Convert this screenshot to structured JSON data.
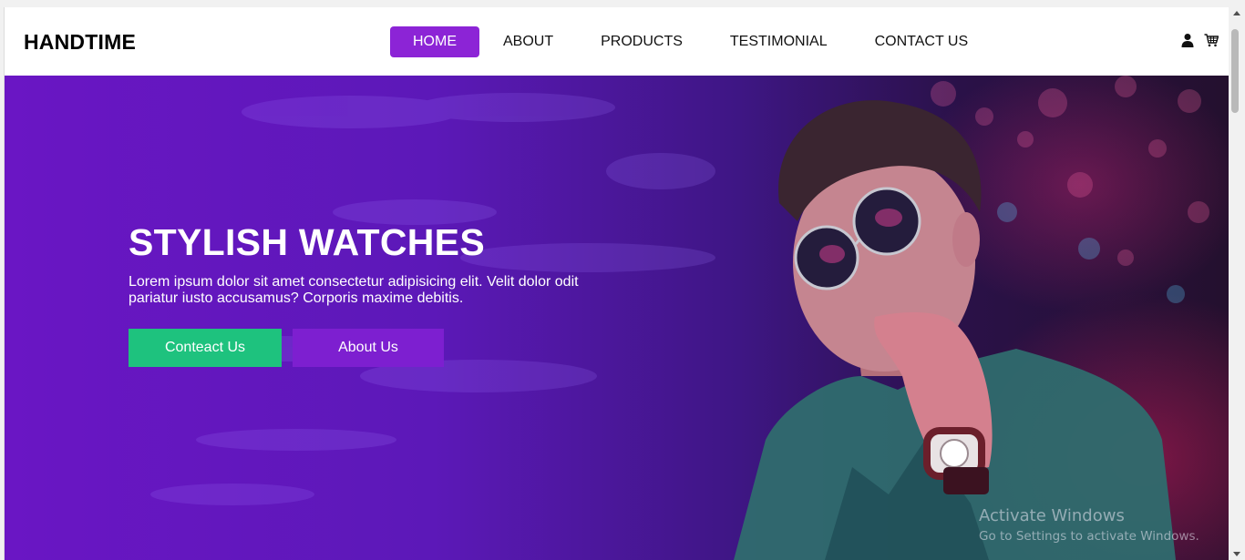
{
  "brand": {
    "logo": "HANDTIME"
  },
  "nav": {
    "items": [
      {
        "label": "HOME",
        "active": true
      },
      {
        "label": "ABOUT",
        "active": false
      },
      {
        "label": "PRODUCTS",
        "active": false
      },
      {
        "label": "TESTIMONIAL",
        "active": false
      },
      {
        "label": "CONTACT US",
        "active": false
      }
    ],
    "icons": [
      "user-icon",
      "cart-icon"
    ]
  },
  "hero": {
    "title": "STYLISH WATCHES",
    "text": "Lorem ipsum dolor sit amet consectetur adipisicing elit. Velit dolor odit pariatur iusto accusamus? Corporis maxime debitis.",
    "contact_button": "Conteact Us",
    "about_button": "About Us"
  },
  "watermark": {
    "title": "Activate Windows",
    "subtitle": "Go to Settings to activate Windows."
  },
  "colors": {
    "accent": "#8c24d6",
    "contact_button": "#1ec27e",
    "about_button": "#7d1fd0"
  }
}
